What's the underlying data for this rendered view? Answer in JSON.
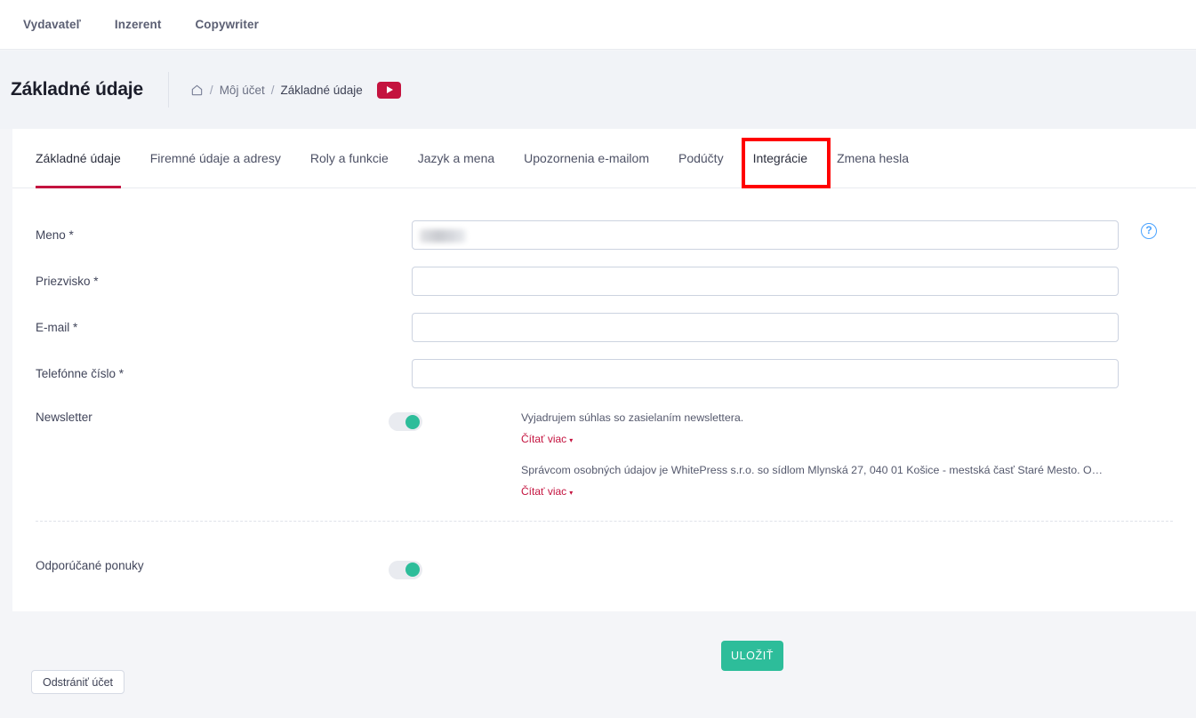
{
  "topnav": {
    "items": [
      {
        "label": "Vydavateľ"
      },
      {
        "label": "Inzerent"
      },
      {
        "label": "Copywriter"
      }
    ]
  },
  "header": {
    "title": "Základné údaje",
    "breadcrumb": {
      "home_icon": "home-icon",
      "sep": "/",
      "items": [
        {
          "label": "Môj účet"
        },
        {
          "label": "Základné údaje"
        }
      ]
    },
    "youtube_button": "youtube-play-icon"
  },
  "tabs": [
    {
      "label": "Základné údaje",
      "active": true
    },
    {
      "label": "Firemné údaje a adresy",
      "active": false
    },
    {
      "label": "Roly a funkcie",
      "active": false
    },
    {
      "label": "Jazyk a mena",
      "active": false
    },
    {
      "label": "Upozornenia e-mailom",
      "active": false
    },
    {
      "label": "Podúčty",
      "active": false
    },
    {
      "label": "Integrácie",
      "active": false,
      "highlighted": true
    },
    {
      "label": "Zmena hesla",
      "active": false
    }
  ],
  "annotation": {
    "color": "#ff0000",
    "target_tab": "Integrácie"
  },
  "form": {
    "fields": [
      {
        "label": "Meno *",
        "value": "",
        "placeholder": "",
        "redacted": true
      },
      {
        "label": "Priezvisko *",
        "value": "",
        "placeholder": ""
      },
      {
        "label": "E-mail *",
        "value": "",
        "placeholder": ""
      },
      {
        "label": "Telefónne číslo *",
        "value": "",
        "placeholder": ""
      }
    ],
    "help_icon": "question-mark-circle-icon"
  },
  "newsletter": {
    "label": "Newsletter",
    "toggle_on": true,
    "consents": [
      {
        "text": "Vyjadrujem súhlas so zasielaním newslettera.",
        "read_more": "Čítať viac",
        "caret": "▾"
      },
      {
        "text": "Správcom osobných údajov je WhitePress s.r.o. so sídlom Mlynská 27, 040 01 Košice - mestská časť Staré Mesto. Osobné ú...",
        "read_more": "Čítať viac",
        "caret": "▾"
      }
    ]
  },
  "recommended": {
    "label": "Odporúčané ponuky",
    "toggle_on": true
  },
  "footer": {
    "save_label": "ULOŽIŤ",
    "delete_label": "Odstrániť účet"
  },
  "colors": {
    "accent_red": "#c4133f",
    "toggle_green": "#2dbd9a",
    "annotation_red": "#ff0000",
    "help_blue": "#4aa3ff"
  }
}
